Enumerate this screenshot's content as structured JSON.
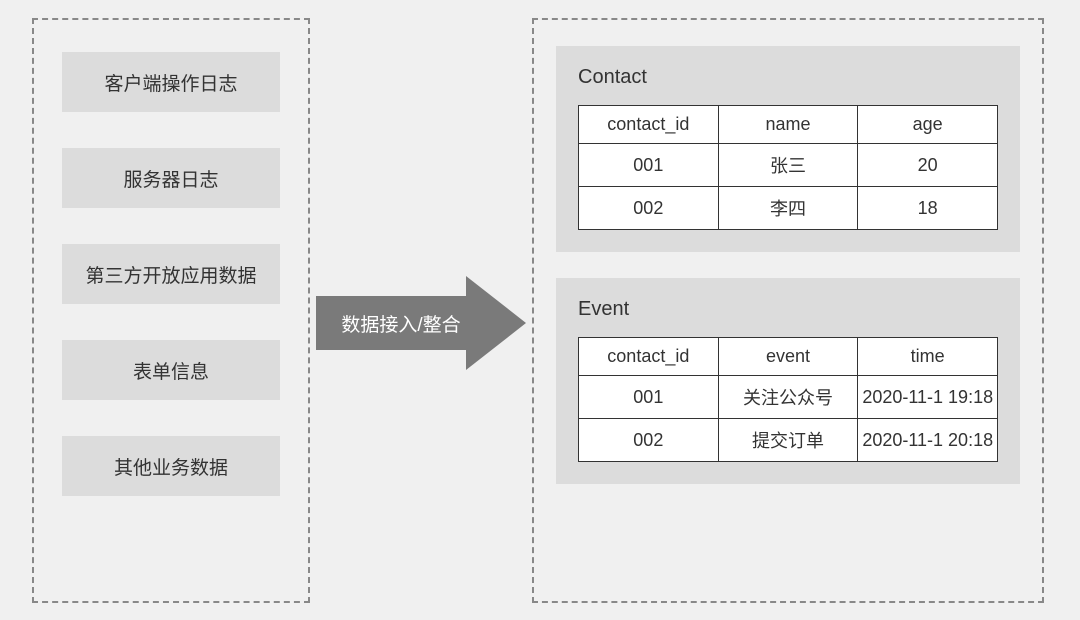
{
  "left": {
    "sources": [
      "客户端操作日志",
      "服务器日志",
      "第三方开放应用数据",
      "表单信息",
      "其他业务数据"
    ]
  },
  "arrow": {
    "label": "数据接入/整合"
  },
  "right": {
    "contact": {
      "title": "Contact",
      "headers": [
        "contact_id",
        "name",
        "age"
      ],
      "rows": [
        [
          "001",
          "张三",
          "20"
        ],
        [
          "002",
          "李四",
          "18"
        ]
      ]
    },
    "event": {
      "title": "Event",
      "headers": [
        "contact_id",
        "event",
        "time"
      ],
      "rows": [
        [
          "001",
          "关注公众号",
          "2020-11-1 19:18"
        ],
        [
          "002",
          "提交订单",
          "2020-11-1 20:18"
        ]
      ]
    }
  }
}
